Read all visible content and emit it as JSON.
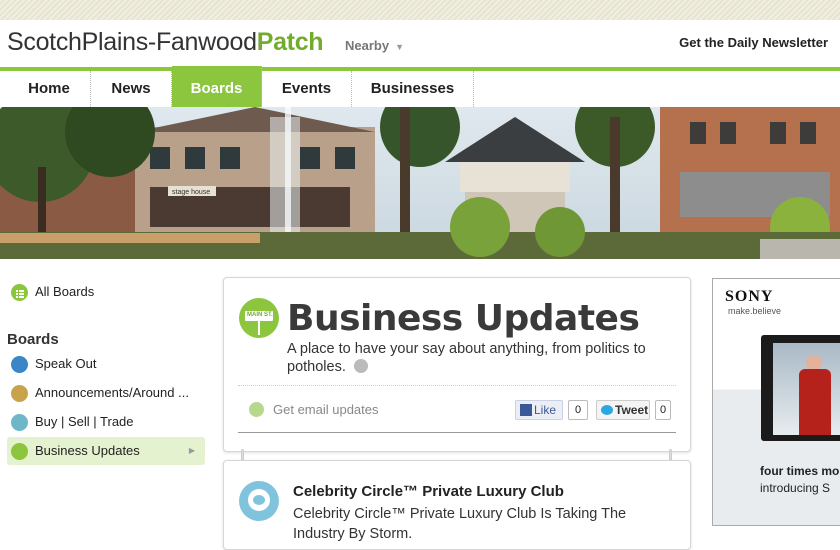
{
  "header": {
    "logo_town": "ScotchPlains-Fanwood",
    "logo_patch": "Patch",
    "nearby_label": "Nearby",
    "newsletter_label": "Get the Daily Newsletter"
  },
  "nav": {
    "items": [
      {
        "label": "Home"
      },
      {
        "label": "News"
      },
      {
        "label": "Boards"
      },
      {
        "label": "Events"
      },
      {
        "label": "Businesses"
      }
    ],
    "active_index": 2
  },
  "hero": {
    "sign_text": "stage house"
  },
  "sidebar": {
    "all_boards": "All Boards",
    "heading": "Boards",
    "items": [
      {
        "label": "Speak Out",
        "icon": "speech-bubble-icon"
      },
      {
        "label": "Announcements/Around ...",
        "icon": "megaphone-icon"
      },
      {
        "label": "Buy | Sell | Trade",
        "icon": "arrows-icon"
      },
      {
        "label": "Business Updates",
        "icon": "sign-icon"
      }
    ],
    "active_index": 3
  },
  "board": {
    "badge_text": "MAIN ST.",
    "title": "Business Updates",
    "description": "A place to have your say about anything, from politics to potholes.",
    "email_updates": "Get email updates",
    "like_label": "Like",
    "like_count": "0",
    "tweet_label": "Tweet",
    "tweet_count": "0"
  },
  "post": {
    "title": "Celebrity Circle™ Private Luxury Club",
    "body": "Celebrity Circle™ Private Luxury Club Is Taking The Industry By Storm."
  },
  "ad": {
    "brand": "SONY",
    "tagline": "make.believe",
    "line1": "four times mo",
    "line2": "introducing S"
  },
  "colors": {
    "brand_green": "#8cc63f",
    "patch_green": "#72ac2d",
    "facebook_blue": "#3b5998",
    "twitter_blue": "#2aa9e0"
  }
}
